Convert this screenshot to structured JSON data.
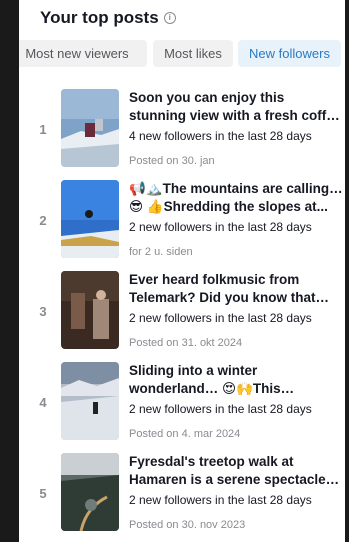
{
  "header": {
    "title": "Your top posts",
    "info_icon": "info-icon"
  },
  "tabs": [
    {
      "label": "Most new viewers",
      "active": false
    },
    {
      "label": "Most likes",
      "active": false
    },
    {
      "label": "New followers",
      "active": true
    }
  ],
  "posts": [
    {
      "rank": "1",
      "caption": "Soon you can enjoy this stunning view with a fresh coffee and waff...",
      "followers": "4 new followers in the last 28 days",
      "date": "Posted on 30. jan"
    },
    {
      "rank": "2",
      "caption": "📢🏔️The mountains are calling… 😎 👍Shredding the slopes at...",
      "followers": "2 new followers in the last 28 days",
      "date": "for 2 u. siden"
    },
    {
      "rank": "3",
      "caption": "Ever heard folkmusic from Telemark? Did you know that this...",
      "followers": "2 new followers in the last 28 days",
      "date": "Posted on 31. okt 2024"
    },
    {
      "rank": "4",
      "caption": "Sliding into a winter wonderland… 😍🙌This breathtaking spot is lik...",
      "followers": "2 new followers in the last 28 days",
      "date": "Posted on 4. mar 2024"
    },
    {
      "rank": "5",
      "caption": "Fyresdal's treetop walk at Hamaren is a serene spectacle in...",
      "followers": "2 new followers in the last 28 days",
      "date": "Posted on 30. nov 2023"
    }
  ],
  "colors": {
    "accent": "#2a7ac2",
    "active_tab_bg": "#e8f2fb",
    "text": "#161823",
    "muted": "#8a8b91"
  }
}
